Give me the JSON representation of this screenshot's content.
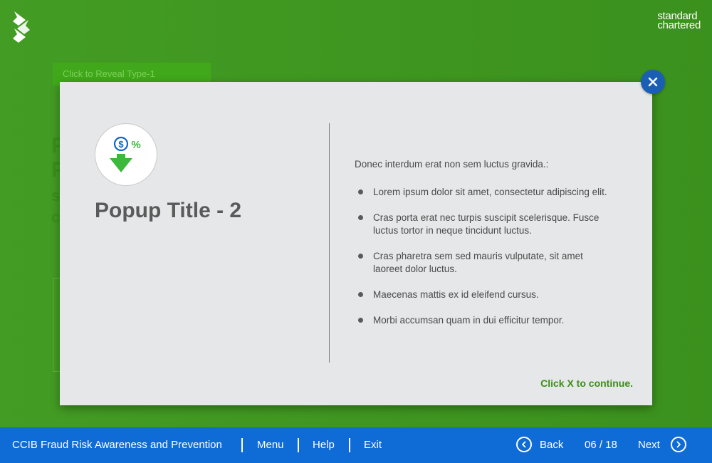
{
  "background": {
    "reveal_label": "Click to Reveal Type-1"
  },
  "brand": {
    "line1": "standard",
    "line2": "chartered"
  },
  "popup": {
    "title": "Popup Title - 2",
    "intro": "Donec interdum erat non sem luctus gravida.:",
    "bullets": [
      "Lorem ipsum dolor sit amet, consectetur adipiscing elit.",
      "Cras porta erat nec turpis suscipit scelerisque. Fusce luctus tortor in neque tincidunt luctus.",
      "Cras pharetra sem sed mauris vulputate, sit amet laoreet dolor luctus.",
      "Maecenas mattis ex id eleifend cursus.",
      "Morbi accumsan quam in dui efficitur tempor."
    ],
    "continue_text": "Click X to continue.",
    "icon": "dollar-percent-down-arrow-icon"
  },
  "footer": {
    "course_title": "CCIB Fraud Risk Awareness and Prevention",
    "menu": "Menu",
    "help": "Help",
    "exit": "Exit",
    "back": "Back",
    "page_indicator": "06 / 18",
    "next": "Next"
  },
  "colors": {
    "background_green": "#3f9a1f",
    "footer_blue": "#0f6bd6",
    "close_blue": "#1a5fb4",
    "continue_green": "#3a8f15",
    "icon_green": "#3cb83c",
    "icon_blue": "#1565c0"
  }
}
